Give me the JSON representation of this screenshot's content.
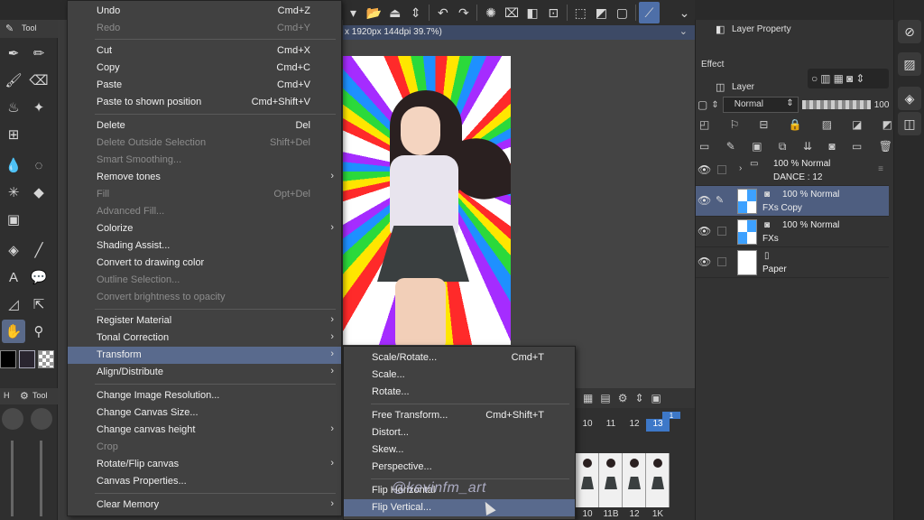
{
  "tools_panel": {
    "tab_label": "Tool",
    "sub_tab_label": "Tool",
    "sub_tab_prefix": "H"
  },
  "canvas": {
    "info": "x 1920px 144dpi 39.7%)"
  },
  "edit_menu": {
    "items": [
      {
        "label": "Undo",
        "shortcut": "Cmd+Z",
        "disabled": false
      },
      {
        "label": "Redo",
        "shortcut": "Cmd+Y",
        "disabled": true
      },
      {
        "label": "Cut",
        "shortcut": "Cmd+X",
        "disabled": false
      },
      {
        "label": "Copy",
        "shortcut": "Cmd+C",
        "disabled": false
      },
      {
        "label": "Paste",
        "shortcut": "Cmd+V",
        "disabled": false
      },
      {
        "label": "Paste to shown position",
        "shortcut": "Cmd+Shift+V",
        "disabled": false
      },
      {
        "label": "Delete",
        "shortcut": "Del",
        "disabled": false
      },
      {
        "label": "Delete Outside Selection",
        "shortcut": "Shift+Del",
        "disabled": true
      },
      {
        "label": "Smart Smoothing...",
        "shortcut": "",
        "disabled": true
      },
      {
        "label": "Remove tones",
        "shortcut": "",
        "disabled": false,
        "submenu": true
      },
      {
        "label": "Fill",
        "shortcut": "Opt+Del",
        "disabled": true
      },
      {
        "label": "Advanced Fill...",
        "shortcut": "",
        "disabled": true
      },
      {
        "label": "Colorize",
        "shortcut": "",
        "disabled": false,
        "submenu": true
      },
      {
        "label": "Shading Assist...",
        "shortcut": "",
        "disabled": false
      },
      {
        "label": "Convert to drawing color",
        "shortcut": "",
        "disabled": false
      },
      {
        "label": "Outline Selection...",
        "shortcut": "",
        "disabled": true
      },
      {
        "label": "Convert brightness to opacity",
        "shortcut": "",
        "disabled": true
      },
      {
        "label": "Register Material",
        "shortcut": "",
        "disabled": false,
        "submenu": true
      },
      {
        "label": "Tonal Correction",
        "shortcut": "",
        "disabled": false,
        "submenu": true
      },
      {
        "label": "Transform",
        "shortcut": "",
        "disabled": false,
        "submenu": true,
        "highlight": true
      },
      {
        "label": "Align/Distribute",
        "shortcut": "",
        "disabled": false,
        "submenu": true
      },
      {
        "label": "Change Image Resolution...",
        "shortcut": "",
        "disabled": false
      },
      {
        "label": "Change Canvas Size...",
        "shortcut": "",
        "disabled": false
      },
      {
        "label": "Change canvas height",
        "shortcut": "",
        "disabled": false,
        "submenu": true
      },
      {
        "label": "Crop",
        "shortcut": "",
        "disabled": true
      },
      {
        "label": "Rotate/Flip canvas",
        "shortcut": "",
        "disabled": false,
        "submenu": true
      },
      {
        "label": "Canvas Properties...",
        "shortcut": "",
        "disabled": false
      },
      {
        "label": "Clear Memory",
        "shortcut": "",
        "disabled": false,
        "submenu": true
      }
    ]
  },
  "transform_submenu": {
    "items": [
      {
        "label": "Scale/Rotate...",
        "shortcut": "Cmd+T"
      },
      {
        "label": "Scale...",
        "shortcut": ""
      },
      {
        "label": "Rotate...",
        "shortcut": ""
      },
      {
        "label": "Free Transform...",
        "shortcut": "Cmd+Shift+T"
      },
      {
        "label": "Distort...",
        "shortcut": ""
      },
      {
        "label": "Skew...",
        "shortcut": ""
      },
      {
        "label": "Perspective...",
        "shortcut": ""
      },
      {
        "label": "Flip Horizontal",
        "shortcut": ""
      },
      {
        "label": "Flip Vertical...",
        "shortcut": "",
        "highlight": true
      }
    ]
  },
  "timeline": {
    "frames": [
      "10",
      "11",
      "12",
      "13"
    ],
    "top_frame": "1",
    "thumb_labels": [
      "10",
      "11B",
      "12",
      "1K"
    ]
  },
  "layer_property": {
    "tab_label": "Layer Property",
    "effect_label": "Effect"
  },
  "layer_panel": {
    "tab_label": "Layer",
    "blend_mode": "Normal",
    "opacity": "100",
    "layers": [
      {
        "mode": "100 % Normal",
        "name": "DANCE : 12",
        "folder": true,
        "selected": false
      },
      {
        "mode": "100 % Normal",
        "name": "FXs Copy",
        "folder": false,
        "selected": true
      },
      {
        "mode": "100 % Normal",
        "name": "FXs",
        "folder": false,
        "selected": false
      },
      {
        "mode": "",
        "name": "Paper",
        "folder": false,
        "selected": false,
        "paper": true
      }
    ]
  },
  "watermark": "@kevinfm_art"
}
